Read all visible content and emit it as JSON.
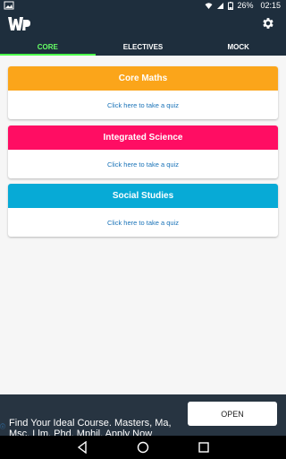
{
  "status": {
    "battery": "26%",
    "time": "02:15"
  },
  "tabs": [
    {
      "label": "CORE"
    },
    {
      "label": "ELECTIVES"
    },
    {
      "label": "MOCK"
    }
  ],
  "cards": [
    {
      "title": "Core Maths",
      "link": "Click here to take a quiz",
      "color": "#fba51a"
    },
    {
      "title": "Integrated Science",
      "link": "Click here to take a quiz",
      "color": "#ff0d63"
    },
    {
      "title": "Social Studies",
      "link": "Click here to take a quiz",
      "color": "#07aad6"
    }
  ],
  "ad": {
    "headline": "Find Your Ideal Course. Masters, Ma,",
    "subline": "Msc, Llm, Phd, Mphil, Apply Now",
    "button": "OPEN"
  },
  "colors": {
    "app_bar": "#1e2e3d",
    "active_tab": "#66ff66",
    "link": "#1a73b8"
  }
}
